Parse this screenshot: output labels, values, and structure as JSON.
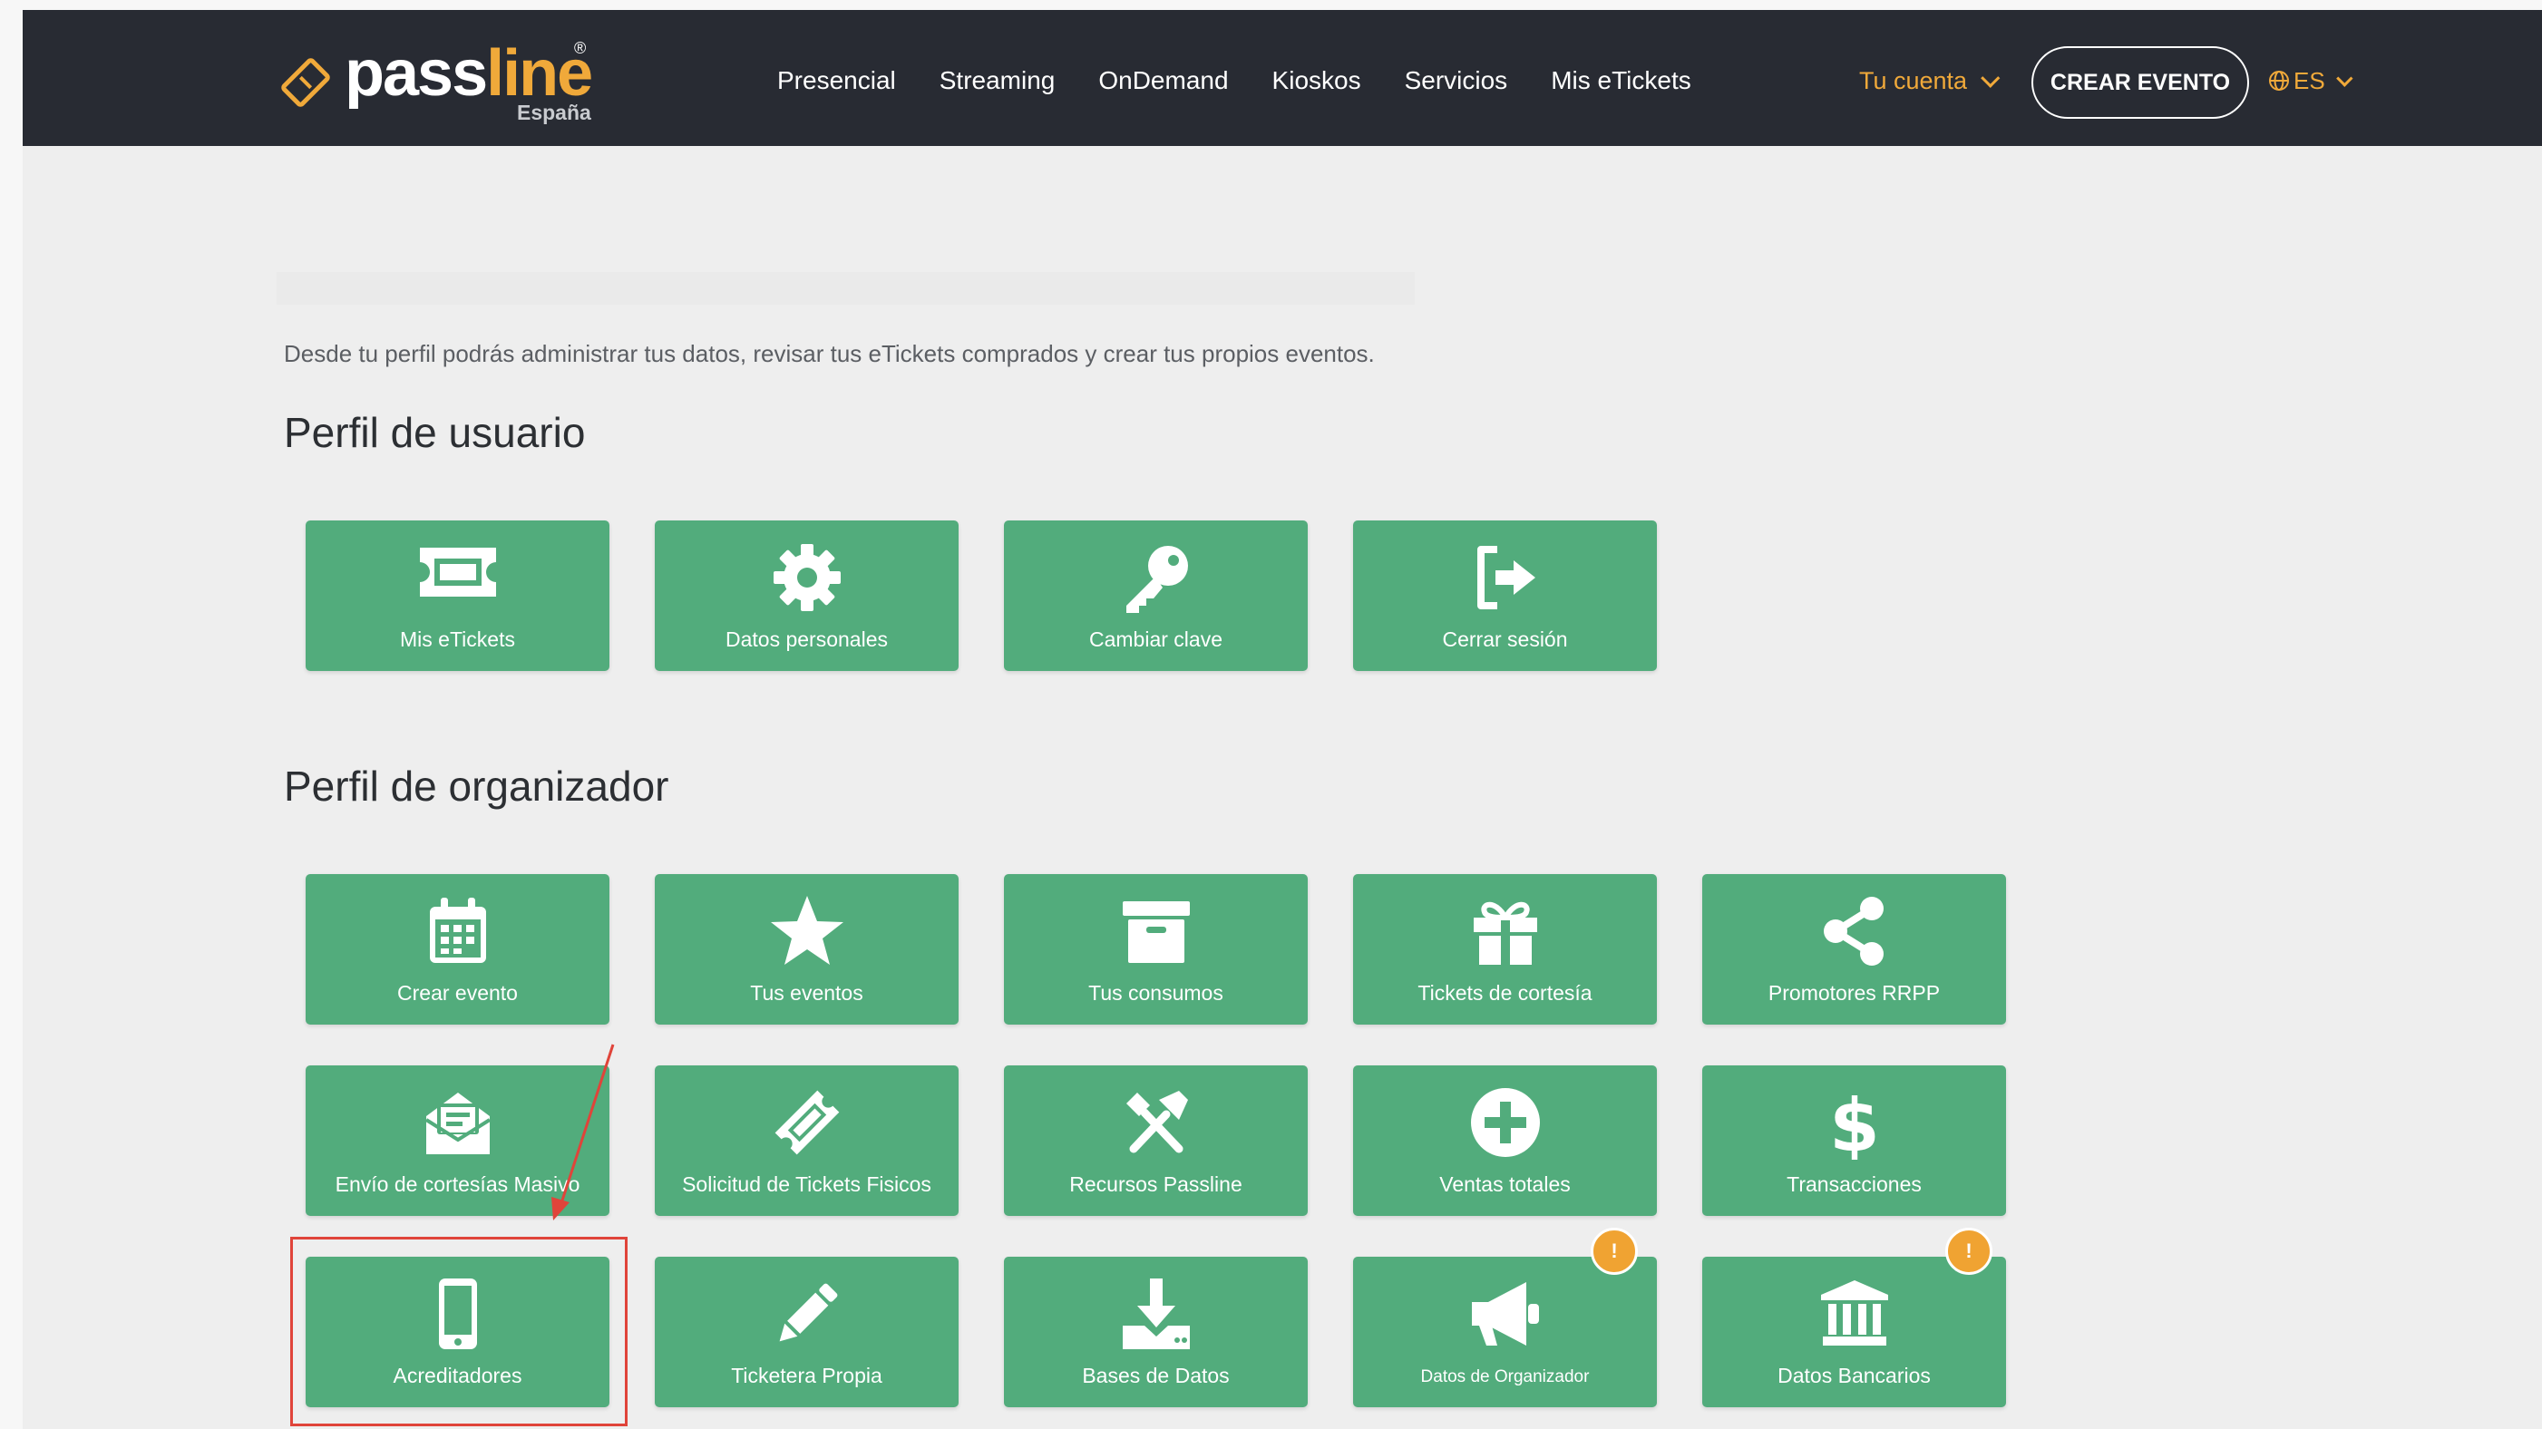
{
  "header": {
    "brand": "passline",
    "brand_registered": "®",
    "brand_country": "España",
    "nav": [
      "Presencial",
      "Streaming",
      "OnDemand",
      "Kioskos",
      "Servicios",
      "Mis eTickets"
    ],
    "account_label": "Tu cuenta",
    "create_event_label": "CREAR EVENTO",
    "language": "ES"
  },
  "intro_text": "Desde tu perfil podrás administrar tus datos, revisar tus eTickets comprados y crear tus propios eventos.",
  "user_section": {
    "title": "Perfil de usuario",
    "tiles": [
      {
        "label": "Mis eTickets",
        "icon": "ticket-icon"
      },
      {
        "label": "Datos personales",
        "icon": "gear-icon"
      },
      {
        "label": "Cambiar clave",
        "icon": "key-icon"
      },
      {
        "label": "Cerrar sesión",
        "icon": "logout-icon"
      }
    ]
  },
  "organizer_section": {
    "title": "Perfil de organizador",
    "tiles": [
      {
        "label": "Crear evento",
        "icon": "calendar-icon"
      },
      {
        "label": "Tus eventos",
        "icon": "star-icon"
      },
      {
        "label": "Tus consumos",
        "icon": "archive-icon"
      },
      {
        "label": "Tickets de cortesía",
        "icon": "gift-icon"
      },
      {
        "label": "Promotores RRPP",
        "icon": "share-icon"
      },
      {
        "label": "Envío de cortesías Masivo",
        "icon": "envelope-open-icon"
      },
      {
        "label": "Solicitud de Tickets Fisicos",
        "icon": "ticket-tilted-icon"
      },
      {
        "label": "Recursos Passline",
        "icon": "tools-icon"
      },
      {
        "label": "Ventas totales",
        "icon": "plus-circle-icon"
      },
      {
        "label": "Transacciones",
        "icon": "dollar-icon"
      },
      {
        "label": "Acreditadores",
        "icon": "mobile-icon"
      },
      {
        "label": "Ticketera Propia",
        "icon": "pencil-icon"
      },
      {
        "label": "Bases de Datos",
        "icon": "download-icon"
      },
      {
        "label": "Datos de Organizador",
        "icon": "megaphone-icon",
        "badge": "!"
      },
      {
        "label": "Datos Bancarios",
        "icon": "bank-icon",
        "badge": "!"
      }
    ]
  },
  "colors": {
    "navbar": "#282b33",
    "accent": "#f0a93a",
    "tile": "#52ac7c",
    "highlight": "#e0443a"
  }
}
